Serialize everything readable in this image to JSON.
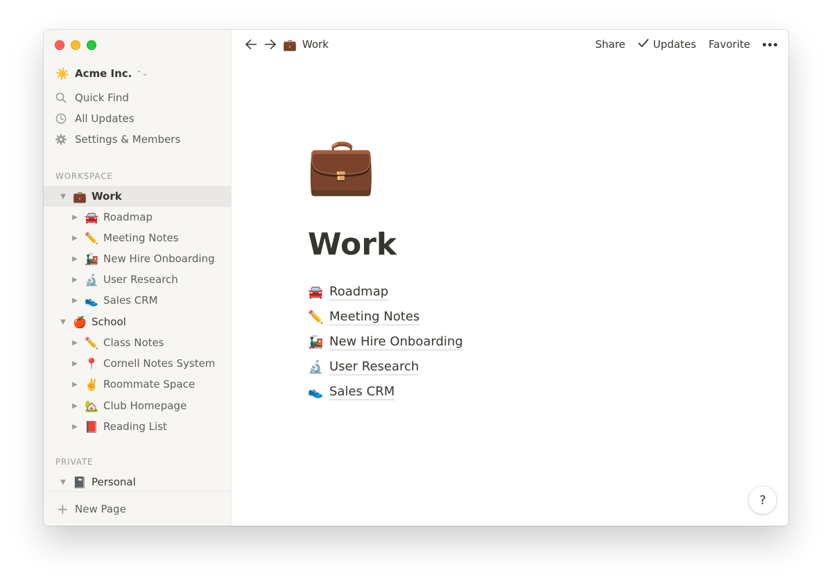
{
  "sidebar": {
    "workspace": {
      "emoji": "☀️",
      "name": "Acme Inc."
    },
    "nav": [
      {
        "label": "Quick Find",
        "icon": "search-icon"
      },
      {
        "label": "All Updates",
        "icon": "clock-icon"
      },
      {
        "label": "Settings & Members",
        "icon": "gear-icon"
      }
    ],
    "sections": {
      "workspace_label": "WORKSPACE",
      "private_label": "PRIVATE"
    },
    "tree": [
      {
        "emoji": "💼",
        "label": "Work",
        "expanded": true,
        "active": true,
        "level": 0
      },
      {
        "emoji": "🚘",
        "label": "Roadmap",
        "level": 1
      },
      {
        "emoji": "✏️",
        "label": "Meeting Notes",
        "level": 1
      },
      {
        "emoji": "🚂",
        "label": "New Hire Onboarding",
        "level": 1
      },
      {
        "emoji": "🔬",
        "label": "User Research",
        "level": 1
      },
      {
        "emoji": "👟",
        "label": "Sales CRM",
        "level": 1
      },
      {
        "emoji": "🍎",
        "label": "School",
        "expanded": true,
        "level": 0
      },
      {
        "emoji": "✏️",
        "label": "Class Notes",
        "level": 1
      },
      {
        "emoji": "📍",
        "label": "Cornell Notes System",
        "level": 1
      },
      {
        "emoji": "✌️",
        "label": "Roommate Space",
        "level": 1
      },
      {
        "emoji": "🏡",
        "label": "Club Homepage",
        "level": 1
      },
      {
        "emoji": "📕",
        "label": "Reading List",
        "level": 1
      },
      {
        "emoji": "📓",
        "label": "Personal",
        "expanded": true,
        "level": 0
      }
    ],
    "new_page_label": "New Page"
  },
  "topbar": {
    "breadcrumb": {
      "emoji": "💼",
      "label": "Work"
    },
    "share_label": "Share",
    "updates_label": "Updates",
    "favorite_label": "Favorite"
  },
  "page": {
    "icon": "💼",
    "title": "Work",
    "links": [
      {
        "emoji": "🚘",
        "label": "Roadmap"
      },
      {
        "emoji": "✏️",
        "label": "Meeting Notes"
      },
      {
        "emoji": "🚂",
        "label": "New Hire Onboarding"
      },
      {
        "emoji": "🔬",
        "label": "User Research"
      },
      {
        "emoji": "👟",
        "label": "Sales CRM"
      }
    ]
  },
  "help_label": "?"
}
